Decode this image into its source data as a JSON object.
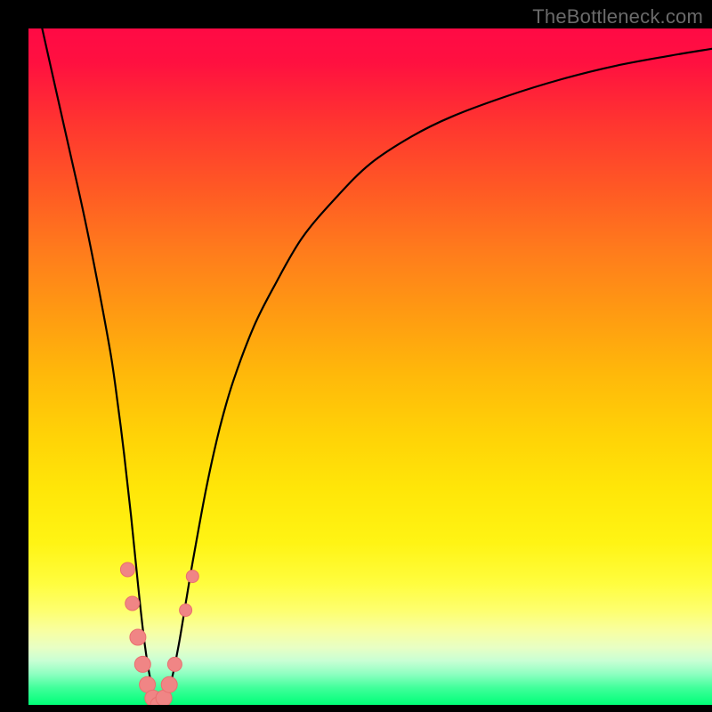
{
  "watermark": "TheBottleneck.com",
  "colors": {
    "frame": "#000000",
    "curve": "#000000",
    "marker_fill": "#f08585",
    "marker_stroke": "#e96f6f"
  },
  "chart_data": {
    "type": "line",
    "title": "",
    "xlabel": "",
    "ylabel": "",
    "xlim": [
      0,
      100
    ],
    "ylim": [
      0,
      100
    ],
    "grid": false,
    "series": [
      {
        "name": "bottleneck-curve",
        "x": [
          2,
          4,
          6,
          8,
          10,
          12,
          13,
          14,
          15,
          16,
          17,
          18,
          19,
          20,
          21,
          22,
          23,
          24,
          26,
          28,
          30,
          33,
          36,
          40,
          45,
          50,
          56,
          62,
          70,
          78,
          86,
          94,
          100
        ],
        "y": [
          100,
          91,
          82,
          73,
          63,
          52,
          45,
          37,
          28,
          18,
          9,
          3,
          0,
          1,
          4,
          9,
          15,
          21,
          32,
          41,
          48,
          56,
          62,
          69,
          75,
          80,
          84,
          87,
          90,
          92.5,
          94.5,
          96,
          97
        ]
      }
    ],
    "markers": [
      {
        "x": 14.5,
        "y": 20,
        "r": 8
      },
      {
        "x": 15.2,
        "y": 15,
        "r": 8
      },
      {
        "x": 16.0,
        "y": 10,
        "r": 9
      },
      {
        "x": 16.7,
        "y": 6,
        "r": 9
      },
      {
        "x": 17.4,
        "y": 3,
        "r": 9
      },
      {
        "x": 18.2,
        "y": 1,
        "r": 9
      },
      {
        "x": 19.0,
        "y": 0,
        "r": 9
      },
      {
        "x": 19.8,
        "y": 1,
        "r": 9
      },
      {
        "x": 20.6,
        "y": 3,
        "r": 9
      },
      {
        "x": 21.4,
        "y": 6,
        "r": 8
      },
      {
        "x": 23.0,
        "y": 14,
        "r": 7
      },
      {
        "x": 24.0,
        "y": 19,
        "r": 7
      }
    ]
  }
}
